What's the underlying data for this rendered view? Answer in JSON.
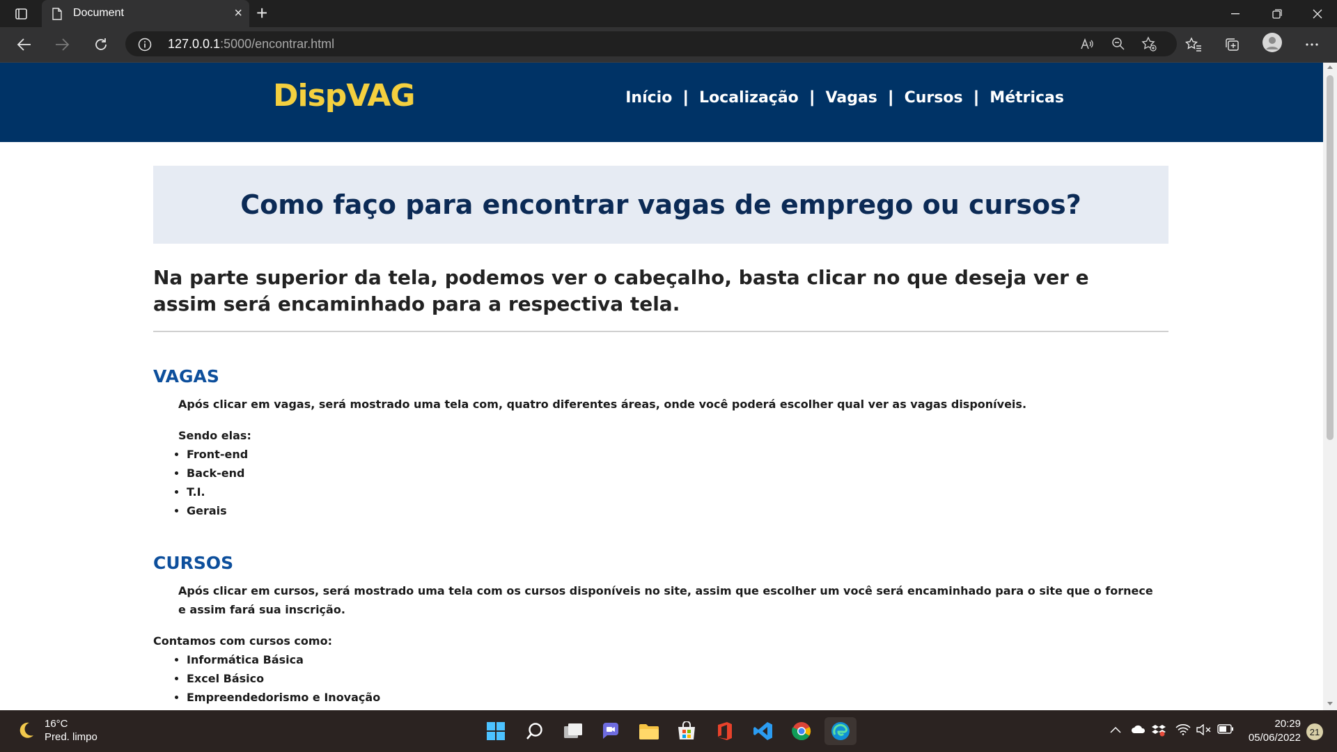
{
  "browser": {
    "tab_title": "Document",
    "url_host": "127.0.0.1",
    "url_path": ":5000/encontrar.html"
  },
  "site": {
    "logo": "DispVAG",
    "nav": [
      "Início",
      "Localização",
      "Vagas",
      "Cursos",
      "Métricas"
    ],
    "colors": {
      "header": "#003366",
      "logo": "#f4d03f",
      "section_title": "#0d4f9c",
      "hero_bg": "#e6ebf3"
    }
  },
  "content": {
    "hero_title": "Como faço para encontrar vagas de emprego ou cursos?",
    "intro": "Na parte superior da tela, podemos ver o cabeçalho, basta clicar no que deseja ver e assim será encaminhado para a respectiva tela.",
    "vagas": {
      "title": "VAGAS",
      "text": "Após clicar em vagas, será mostrado uma tela com, quatro diferentes áreas, onde você poderá escolher qual ver as vagas disponíveis.",
      "list_title": "Sendo elas:",
      "items": [
        "Front-end",
        "Back-end",
        "T.I.",
        "Gerais"
      ]
    },
    "cursos": {
      "title": "CURSOS",
      "text": "Após clicar em cursos, será mostrado uma tela com os cursos disponíveis no site, assim que escolher um você será encaminhado para o site que o fornece e assim fará sua inscrição.",
      "list_title": "Contamos com cursos como:",
      "items": [
        "Informática Básica",
        "Excel Básico",
        "Empreendedorismo e Inovação"
      ]
    }
  },
  "taskbar": {
    "weather_temp": "16°C",
    "weather_desc": "Pred. limpo",
    "time": "20:29",
    "date": "05/06/2022",
    "notifications": "21"
  }
}
